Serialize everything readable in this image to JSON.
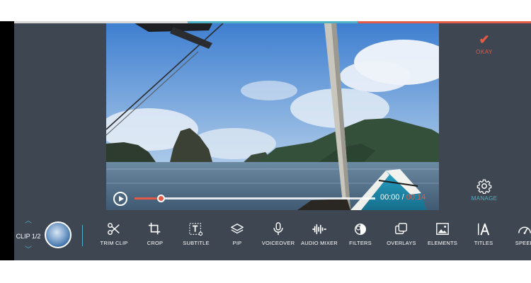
{
  "colors": {
    "accent": "#e45a47",
    "teal": "#4fb0c6",
    "panel": "#3d4651"
  },
  "top_progress_segments": [
    {
      "color": "#d7d7d7",
      "flex": 245
    },
    {
      "color": "#4fb0c6",
      "flex": 240
    },
    {
      "color": "#e45a47",
      "flex": 245
    }
  ],
  "player": {
    "current_time": "00:00",
    "separator": " / ",
    "total_time": "00:14",
    "progress": 0.11
  },
  "right_panel": {
    "okay_label": "OKAY",
    "okay_icon": "checkmark-icon",
    "manage_label": "MANAGE",
    "manage_icon": "gear-icon"
  },
  "clip": {
    "label": "CLIP 1/2"
  },
  "tools": [
    {
      "label": "TRIM CLIP",
      "icon": "scissors-icon"
    },
    {
      "label": "CROP",
      "icon": "crop-icon"
    },
    {
      "label": "SUBTITLE",
      "icon": "subtitle-icon"
    },
    {
      "label": "PIP",
      "icon": "layers-icon"
    },
    {
      "label": "VOICEOVER",
      "icon": "microphone-icon"
    },
    {
      "label": "AUDIO MIXER",
      "icon": "waveform-icon"
    },
    {
      "label": "FILTERS",
      "icon": "filters-icon"
    },
    {
      "label": "OVERLAYS",
      "icon": "overlays-icon"
    },
    {
      "label": "ELEMENTS",
      "icon": "image-icon"
    },
    {
      "label": "TITLES",
      "icon": "titles-icon"
    },
    {
      "label": "SPEED",
      "icon": "speedometer-icon"
    }
  ]
}
